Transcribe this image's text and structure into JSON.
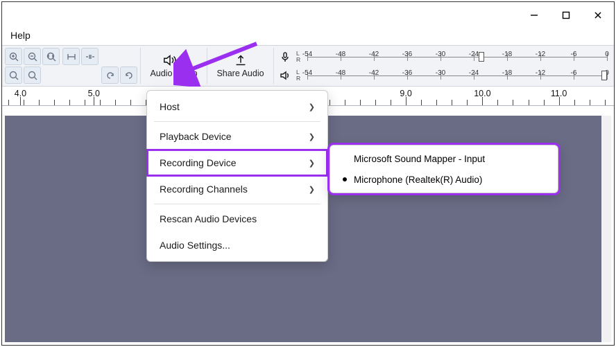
{
  "window": {
    "minimize_tooltip": "Minimize",
    "maximize_tooltip": "Maximize",
    "close_tooltip": "Close"
  },
  "menubar": {
    "help": "Help"
  },
  "toolbar": {
    "audio_setup_label": "Audio Setup",
    "share_audio_label": "Share Audio",
    "meter_labels": {
      "L": "L",
      "R": "R"
    },
    "db_ticks": [
      "-54",
      "-48",
      "-42",
      "-36",
      "-30",
      "-24",
      "-18",
      "-12",
      "-6",
      "0"
    ]
  },
  "timeline": {
    "labels": [
      "4.0",
      "5.0",
      "9.0",
      "10.0",
      "11.0"
    ],
    "positions_pct": [
      3.0,
      15.0,
      66.0,
      78.5,
      91.0
    ]
  },
  "dropdown": {
    "items": [
      {
        "label": "Host",
        "has_submenu": true
      },
      {
        "label": "Playback Device",
        "has_submenu": true
      },
      {
        "label": "Recording Device",
        "has_submenu": true,
        "highlighted": true
      },
      {
        "label": "Recording Channels",
        "has_submenu": true
      },
      {
        "label": "Rescan Audio Devices",
        "has_submenu": false
      },
      {
        "label": "Audio Settings...",
        "has_submenu": false
      }
    ]
  },
  "submenu": {
    "items": [
      {
        "label": "Microsoft Sound Mapper - Input",
        "selected": false
      },
      {
        "label": "Microphone (Realtek(R) Audio)",
        "selected": true
      }
    ]
  },
  "annotation": {
    "color": "#9a2ff0"
  }
}
